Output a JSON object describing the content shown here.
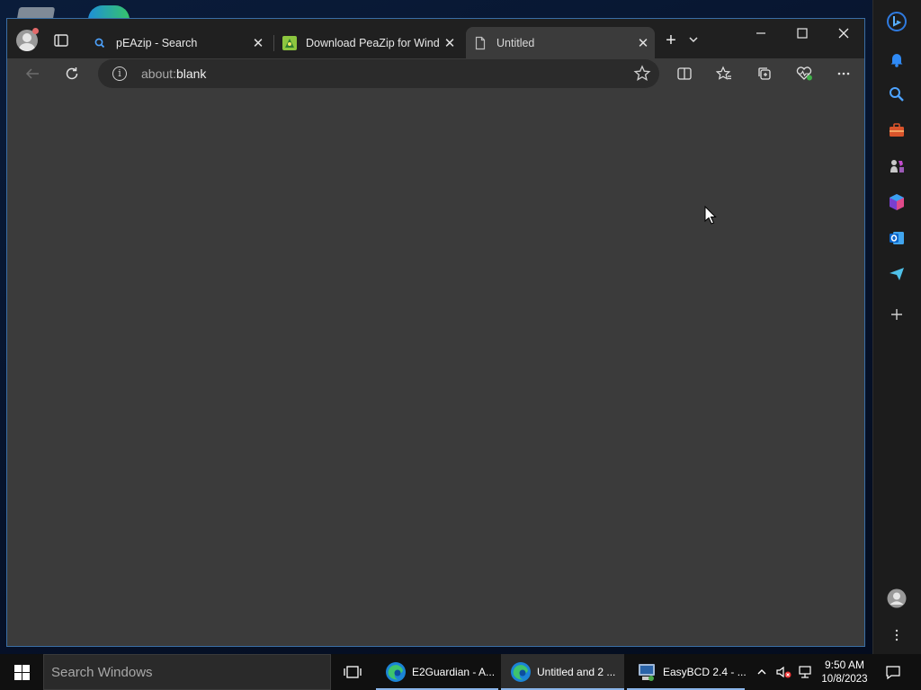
{
  "browser": {
    "tabs": [
      {
        "title": "pEAzip - Search",
        "favicon": "search-icon",
        "active": false
      },
      {
        "title": "Download PeaZip for Windows",
        "favicon": "peazip-icon",
        "active": false
      },
      {
        "title": "Untitled",
        "favicon": "page-icon",
        "active": true
      }
    ],
    "tab_close_glyph": "✕",
    "new_tab_glyph": "+",
    "address": {
      "scheme": "about:",
      "path": "blank"
    },
    "colors": {
      "accent": "#3a6ea5",
      "content_bg": "#3b3b3b",
      "tabstrip_bg": "#202020"
    }
  },
  "sidebar": {
    "items": [
      "bing-icon",
      "bell-icon",
      "search-icon",
      "toolbox-icon",
      "games-icon",
      "office-icon",
      "outlook-icon",
      "send-icon",
      "add-icon",
      "profile-icon",
      "more-icon"
    ]
  },
  "taskbar": {
    "search_placeholder": "Search Windows",
    "apps": [
      {
        "label": "E2Guardian - A...",
        "icon": "edge-icon",
        "active": false
      },
      {
        "label": "Untitled and 2 ...",
        "icon": "edge-icon",
        "active": true
      },
      {
        "label": "EasyBCD 2.4 - ...",
        "icon": "easybcd-icon",
        "active": false
      }
    ],
    "time": "9:50 AM",
    "date": "10/8/2023"
  }
}
